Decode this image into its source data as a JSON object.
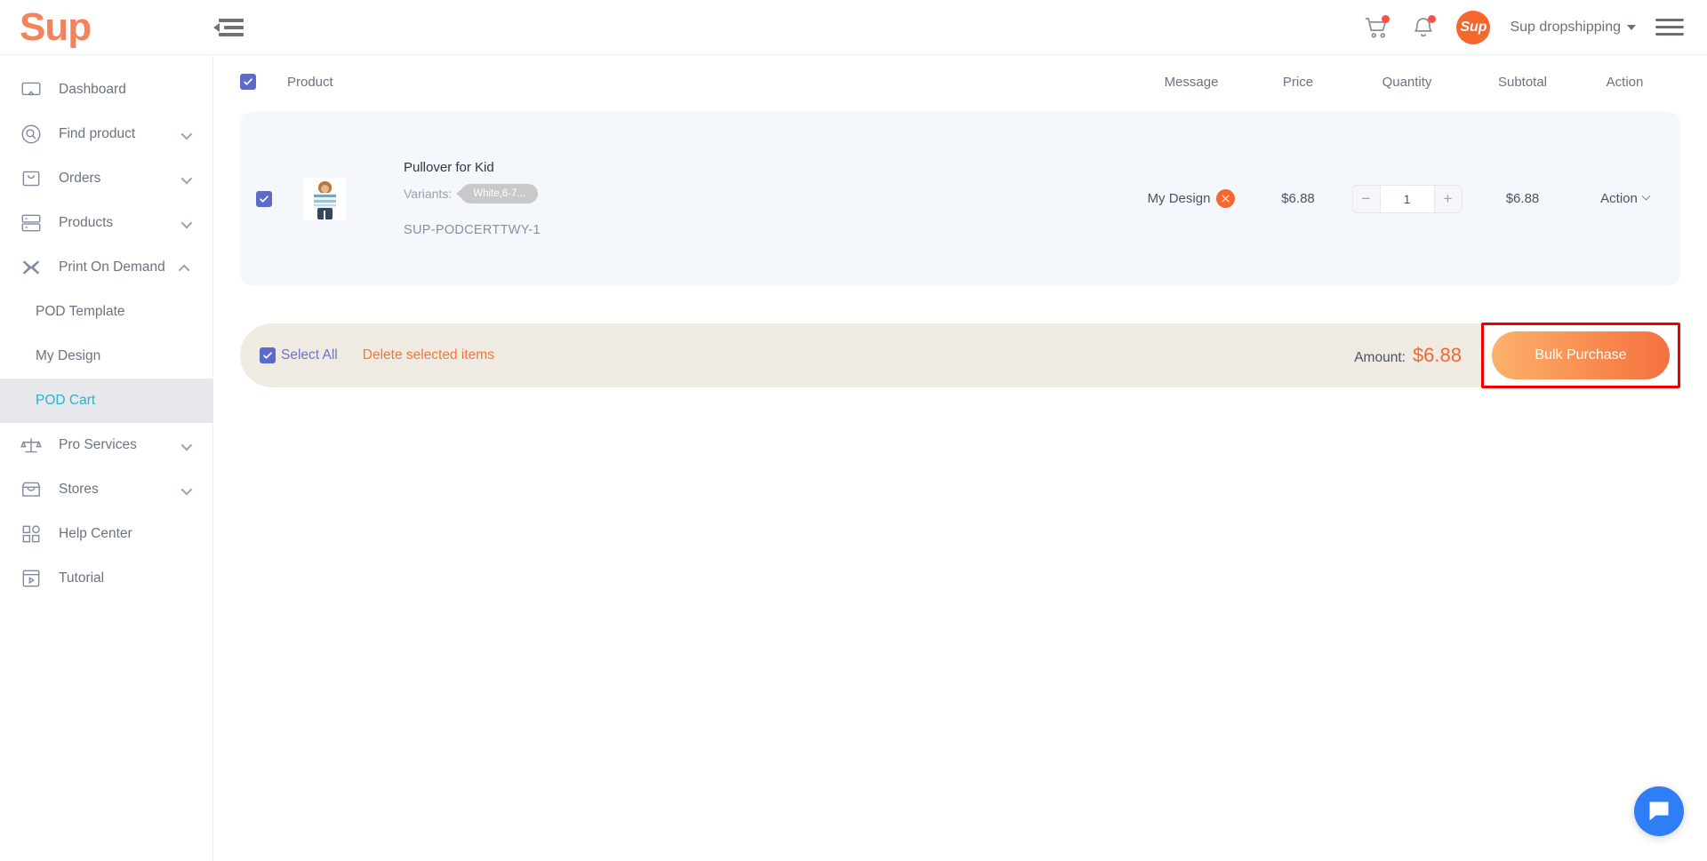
{
  "header": {
    "logo": "Sup",
    "collapse_icon": "sidebar-collapse-icon",
    "cart_icon": "cart-icon",
    "bell_icon": "bell-icon",
    "avatar_text": "Sup",
    "account_name": "Sup dropshipping",
    "menu_icon": "hamburger-menu-icon"
  },
  "sidebar": {
    "items": [
      {
        "label": "Dashboard",
        "icon": "dashboard-icon",
        "expandable": false,
        "active": false
      },
      {
        "label": "Find product",
        "icon": "search-icon",
        "expandable": true,
        "active": false
      },
      {
        "label": "Orders",
        "icon": "bag-icon",
        "expandable": true,
        "active": false
      },
      {
        "label": "Products",
        "icon": "boxes-icon",
        "expandable": true,
        "active": false
      },
      {
        "label": "Print On Demand",
        "icon": "design-icon",
        "expandable": true,
        "expanded": true,
        "active": false
      },
      {
        "label": "Pro Services",
        "icon": "scales-icon",
        "expandable": true,
        "active": false
      },
      {
        "label": "Stores",
        "icon": "store-icon",
        "expandable": true,
        "active": false
      },
      {
        "label": "Help Center",
        "icon": "grid-icon",
        "expandable": false,
        "active": false
      },
      {
        "label": "Tutorial",
        "icon": "video-icon",
        "expandable": false,
        "active": false
      }
    ],
    "sub_items": [
      {
        "label": "POD Template",
        "active": false
      },
      {
        "label": "My Design",
        "active": false
      },
      {
        "label": "POD Cart",
        "active": true
      }
    ]
  },
  "table": {
    "select_all_checked": true,
    "columns": {
      "product": "Product",
      "message": "Message",
      "price": "Price",
      "quantity": "Quantity",
      "subtotal": "Subtotal",
      "action": "Action"
    },
    "rows": [
      {
        "checked": true,
        "thumbnail": "kid-pullover-thumbnail",
        "name": "Pullover for Kid",
        "variants_label": "Variants:",
        "variant_tag": "White,6-7...",
        "sku": "SUP-PODCERTTWY-1",
        "message": "My Design",
        "message_badge_icon": "design-badge-icon",
        "price": "$6.88",
        "qty_minus": "−",
        "quantity": "1",
        "qty_plus": "+",
        "subtotal": "$6.88",
        "action": "Action"
      }
    ]
  },
  "bottom_bar": {
    "select_all_checked": true,
    "select_all": "Select All",
    "delete_selected": "Delete selected items",
    "amount_label": "Amount:",
    "amount_value": "$6.88",
    "bulk_purchase": "Bulk Purchase"
  },
  "chat": {
    "icon": "chat-bubble-icon"
  },
  "colors": {
    "brand_orange": "#f4682e",
    "logo_orange": "#f4825a",
    "checkbox_purple": "#5c6bc8",
    "active_nav_teal": "#2fb0c8",
    "delete_orange": "#f4773a",
    "bottom_bar_beige": "#efebe3",
    "highlight_red": "#ef0000",
    "chat_blue": "#2f7ef5",
    "row_bg": "#f4f7fb"
  }
}
